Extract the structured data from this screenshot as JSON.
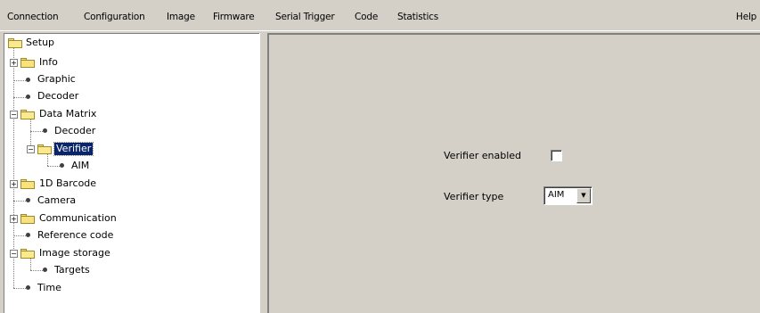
{
  "menu": {
    "items": [
      "Connection",
      "Configuration",
      "Image",
      "Firmware",
      "Serial Trigger",
      "Code",
      "Statistics"
    ],
    "help": "Help"
  },
  "tree": {
    "nodes": [
      {
        "label": "Setup",
        "type": "folder-open",
        "expander": ""
      },
      {
        "label": "Info",
        "type": "folder",
        "expander": "+"
      },
      {
        "label": "Graphic",
        "type": "leaf"
      },
      {
        "label": "Decoder",
        "type": "leaf"
      },
      {
        "label": "Data Matrix",
        "type": "folder-open",
        "expander": "−"
      },
      {
        "label": "Decoder",
        "type": "leaf"
      },
      {
        "label": "Verifier",
        "type": "folder-open",
        "expander": "−",
        "selected": true
      },
      {
        "label": "AIM",
        "type": "leaf"
      },
      {
        "label": "1D Barcode",
        "type": "folder",
        "expander": "+"
      },
      {
        "label": "Camera",
        "type": "leaf"
      },
      {
        "label": "Communication",
        "type": "folder",
        "expander": "+"
      },
      {
        "label": "Reference code",
        "type": "leaf"
      },
      {
        "label": "Image storage",
        "type": "folder-open",
        "expander": "−"
      },
      {
        "label": "Targets",
        "type": "leaf"
      },
      {
        "label": "Time",
        "type": "leaf"
      }
    ]
  },
  "form": {
    "verifier_enabled_label": "Verifier enabled",
    "verifier_enabled_checked": false,
    "verifier_type_label": "Verifier type",
    "verifier_type_value": "AIM"
  }
}
